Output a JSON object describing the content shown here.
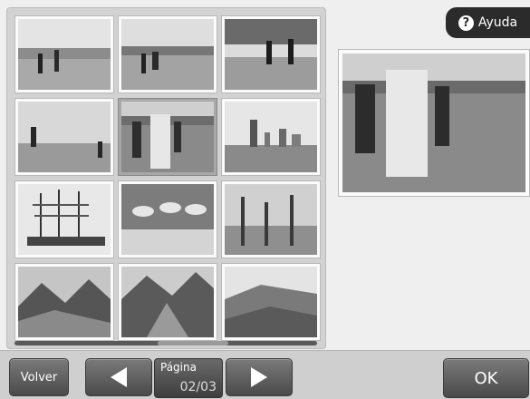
{
  "help": {
    "label": "Ayuda",
    "icon": "question-circle-icon"
  },
  "grid": {
    "thumbnails": [
      {
        "subject": "beach",
        "selected": false
      },
      {
        "subject": "beach",
        "selected": false
      },
      {
        "subject": "beach",
        "selected": false
      },
      {
        "subject": "beach",
        "selected": false
      },
      {
        "subject": "beach-family",
        "selected": true
      },
      {
        "subject": "city-skyline",
        "selected": false
      },
      {
        "subject": "tall-ship",
        "selected": false
      },
      {
        "subject": "seagulls",
        "selected": false
      },
      {
        "subject": "forest",
        "selected": false
      },
      {
        "subject": "mountain-valley",
        "selected": false
      },
      {
        "subject": "mountain-valley",
        "selected": false
      },
      {
        "subject": "hillside",
        "selected": false
      }
    ]
  },
  "navigation": {
    "back_label": "Volver",
    "page_label": "Página",
    "page_value": "02/03",
    "ok_label": "OK",
    "prev_icon": "triangle-left-icon",
    "next_icon": "triangle-right-icon"
  },
  "colors": {
    "background": "#efefef",
    "panel": "#d2d2d2",
    "button_dark": "#4a4a4a",
    "help_tab": "#2b2b2b"
  }
}
